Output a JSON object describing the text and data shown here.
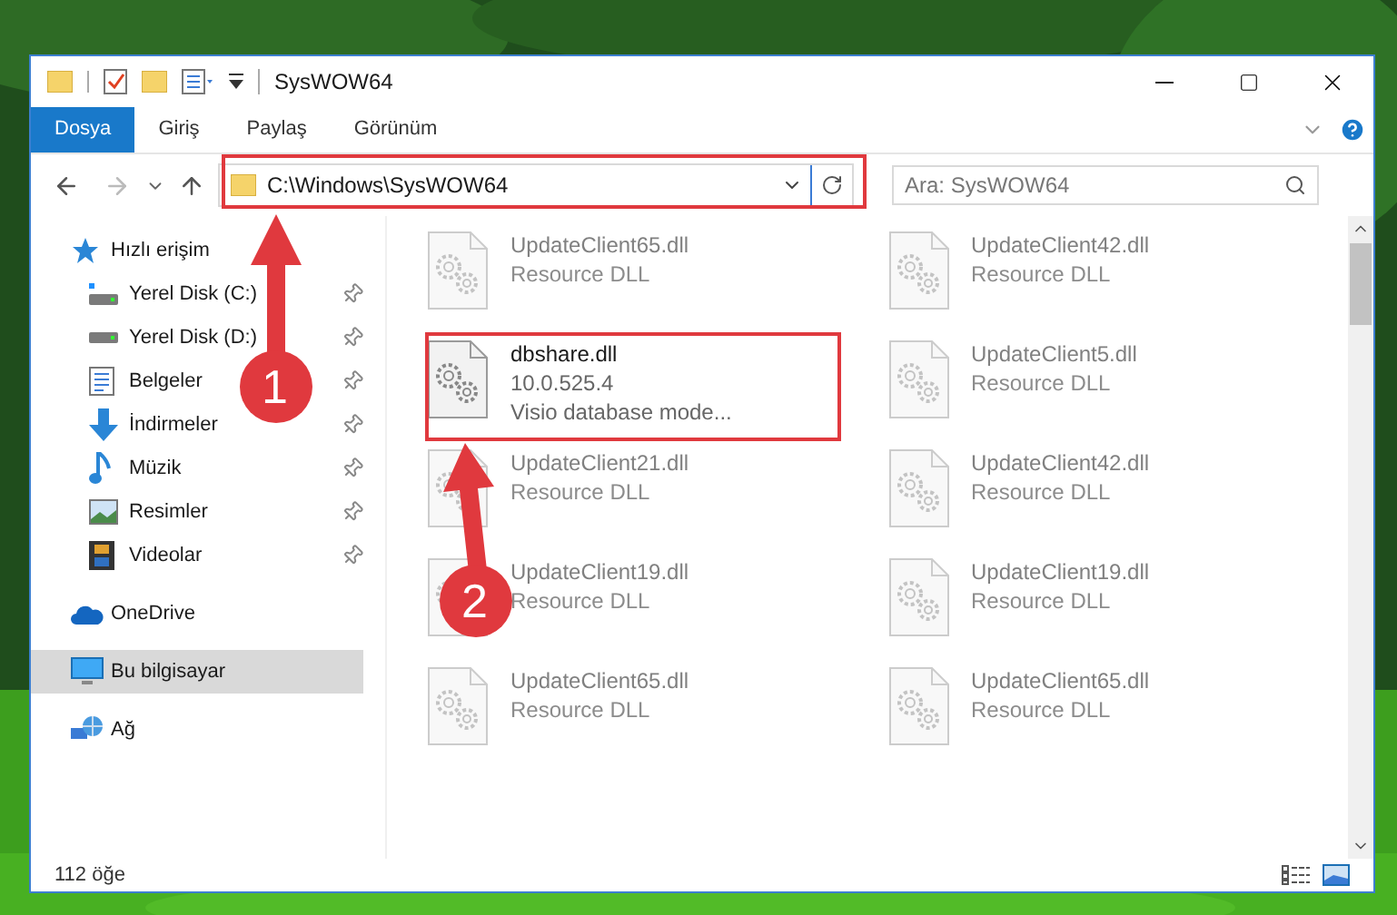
{
  "window": {
    "title": "SysWOW64"
  },
  "ribbon_tabs": [
    {
      "label": "Dosya",
      "selected": true
    },
    {
      "label": "Giriş",
      "selected": false
    },
    {
      "label": "Paylaş",
      "selected": false
    },
    {
      "label": "Görünüm",
      "selected": false
    }
  ],
  "address": {
    "path": "C:\\Windows\\SysWOW64"
  },
  "search": {
    "placeholder": "Ara: SysWOW64"
  },
  "sidebar": {
    "items": [
      {
        "label": "Hızlı erişim",
        "selected": false,
        "children": [
          {
            "label": "Yerel Disk (C:)",
            "pinned": true,
            "selected": false
          },
          {
            "label": "Yerel Disk (D:)",
            "pinned": true,
            "selected": false
          },
          {
            "label": "Belgeler",
            "pinned": true,
            "selected": false
          },
          {
            "label": "İndirmeler",
            "pinned": true,
            "selected": false
          },
          {
            "label": "Müzik",
            "pinned": true,
            "selected": false
          },
          {
            "label": "Resimler",
            "pinned": true,
            "selected": false
          },
          {
            "label": "Videolar",
            "pinned": true,
            "selected": false
          }
        ]
      },
      {
        "label": "OneDrive",
        "selected": false
      },
      {
        "label": "Bu bilgisayar",
        "selected": true
      },
      {
        "label": "Ağ",
        "selected": false
      }
    ]
  },
  "files": [
    {
      "name": "UpdateClient65.dll",
      "lines": [
        "Resource DLL"
      ],
      "blurred": true
    },
    {
      "name": "UpdateClient42.dll",
      "lines": [
        "Resource DLL"
      ],
      "blurred": true
    },
    {
      "name": "dbshare.dll",
      "lines": [
        "10.0.525.4",
        "Visio database mode..."
      ],
      "blurred": false
    },
    {
      "name": "UpdateClient5.dll",
      "lines": [
        "Resource DLL"
      ],
      "blurred": true
    },
    {
      "name": "UpdateClient21.dll",
      "lines": [
        "Resource DLL"
      ],
      "blurred": true
    },
    {
      "name": "UpdateClient42.dll",
      "lines": [
        "Resource DLL"
      ],
      "blurred": true
    },
    {
      "name": "UpdateClient19.dll",
      "lines": [
        "Resource DLL"
      ],
      "blurred": true
    },
    {
      "name": "UpdateClient19.dll",
      "lines": [
        "Resource DLL"
      ],
      "blurred": true
    },
    {
      "name": "UpdateClient65.dll",
      "lines": [
        "Resource DLL"
      ],
      "blurred": true
    },
    {
      "name": "UpdateClient65.dll",
      "lines": [
        "Resource DLL"
      ],
      "blurred": true
    }
  ],
  "callouts": [
    {
      "number": "1"
    },
    {
      "number": "2"
    }
  ],
  "status_bar": {
    "count": "112 öğe"
  }
}
